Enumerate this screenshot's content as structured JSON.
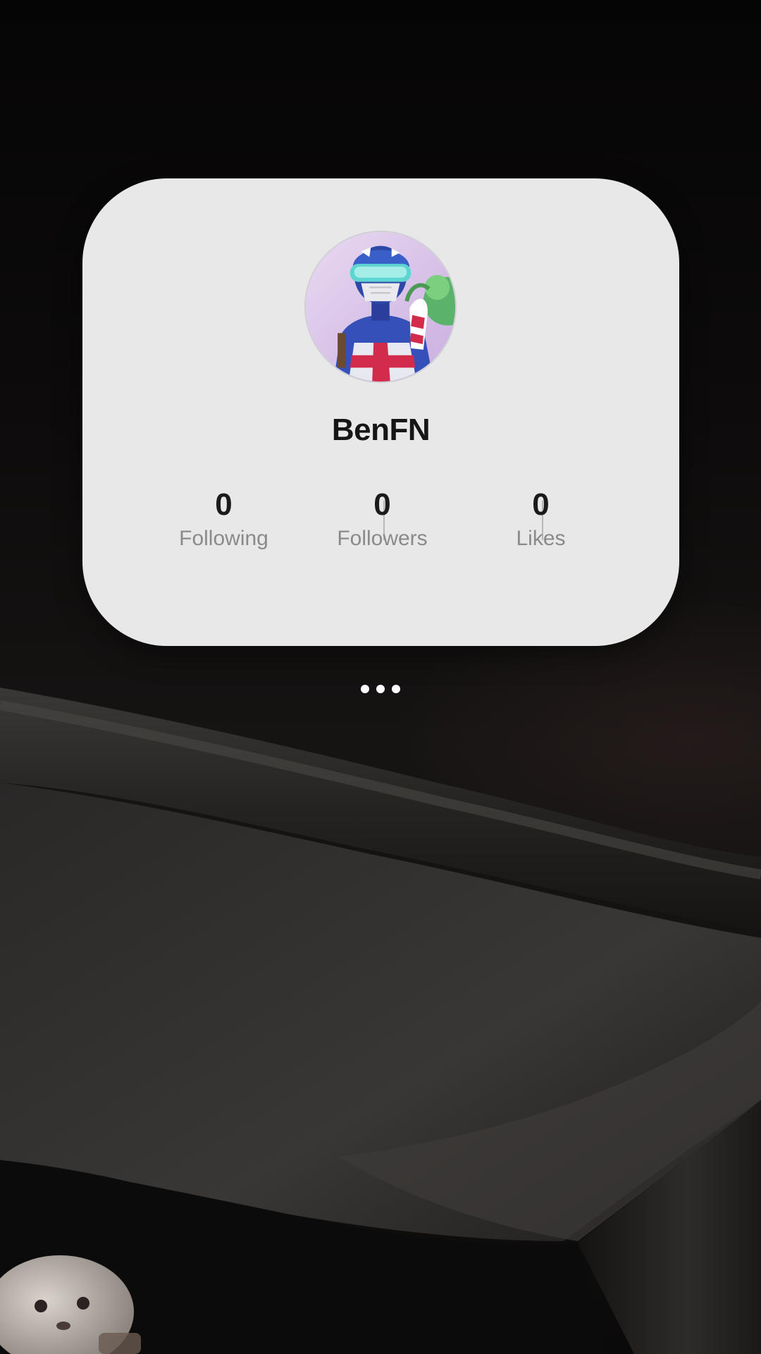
{
  "profile": {
    "username": "BenFN",
    "avatar_icon": "avatar-image"
  },
  "stats": [
    {
      "value": "0",
      "label": "Following"
    },
    {
      "value": "0",
      "label": "Followers"
    },
    {
      "value": "0",
      "label": "Likes"
    }
  ],
  "page_indicator": {
    "icon": "more-dots-icon"
  },
  "colors": {
    "card_background": "#e8e8e9",
    "label_gray": "#8a8a8c",
    "text_dark": "#161616"
  }
}
